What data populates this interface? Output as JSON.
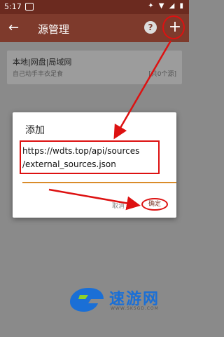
{
  "status_bar": {
    "time": "5:17",
    "notification": "◻"
  },
  "app_bar": {
    "title": "源管理",
    "back_icon": "arrow-left-icon",
    "help_icon": "help-icon",
    "add_icon": "plus-icon"
  },
  "source_card": {
    "name": "本地|网盘|局域网",
    "description": "自己动手丰衣足食",
    "count": "[共0个源]"
  },
  "dialog": {
    "title": "添加",
    "input_value_line1": "https://wdts.top/api/sources",
    "input_value_line2": "/external_sources.json",
    "cancel_label": "取消",
    "confirm_label": "确定"
  },
  "colors": {
    "app_bar": "#7e3a2c",
    "status_bar": "#6b2a1f",
    "annotation": "#dd1111",
    "accent": "#d98c2a"
  },
  "watermark": {
    "name": "速游网",
    "url": "WWW.SKSGD.COM"
  }
}
